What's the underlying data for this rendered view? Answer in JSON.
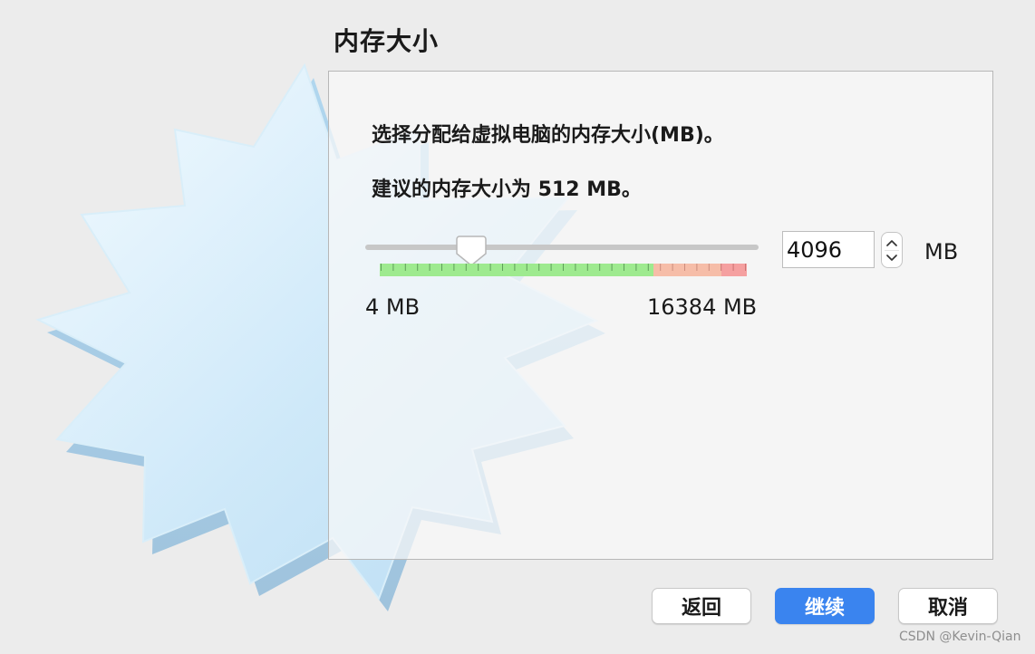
{
  "page": {
    "title": "内存大小",
    "instruction": "选择分配给虚拟电脑的内存大小(MB)。",
    "recommended": {
      "prefix": "建议的内存大小为 ",
      "value": "512",
      "suffix": " MB。"
    }
  },
  "memory": {
    "value": "4096",
    "unit": "MB",
    "slider_value_mb": 4096,
    "min_label": "4 MB",
    "max_label": "16384 MB",
    "range_colors": {
      "safe": "#9eea8f",
      "warning": "#f6bda8",
      "danger": "#f5a0a0"
    }
  },
  "buttons": {
    "back": "返回",
    "continue": "继续",
    "cancel": "取消"
  },
  "watermark": "CSDN @Kevin-Qian",
  "icons": {
    "background": "starburst-icon",
    "slider_thumb": "slider-thumb-icon",
    "step_up": "chevron-up-icon",
    "step_down": "chevron-down-icon"
  }
}
